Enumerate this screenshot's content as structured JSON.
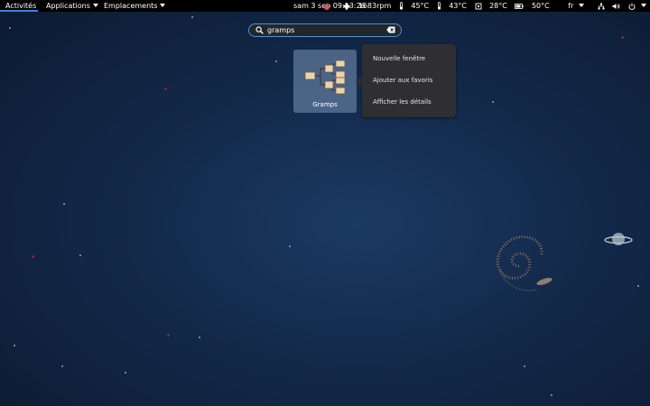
{
  "topbar": {
    "activities": "Activités",
    "applications": "Applications",
    "places": "Emplacements",
    "clock": "sam 3 sep  09:13:26",
    "fan": "1683rpm",
    "temp1": "45°C",
    "temp2": "43°C",
    "temp3": "28°C",
    "temp4": "50°C",
    "lang": "fr"
  },
  "search": {
    "value": "gramps"
  },
  "app": {
    "label": "Gramps"
  },
  "context_menu": {
    "items": [
      "Nouvelle fenêtre",
      "Ajouter aux favoris",
      "Afficher les détails"
    ]
  },
  "icons": [
    "tomato-icon",
    "fan-icon",
    "thermometer-icon",
    "chip-icon",
    "battery-icon",
    "network-icon",
    "volume-icon",
    "power-icon",
    "search-icon",
    "clear-icon"
  ],
  "colors": {
    "accent": "#3584e4",
    "topbar": "#000000",
    "menu_bg": "#2f2f31"
  }
}
